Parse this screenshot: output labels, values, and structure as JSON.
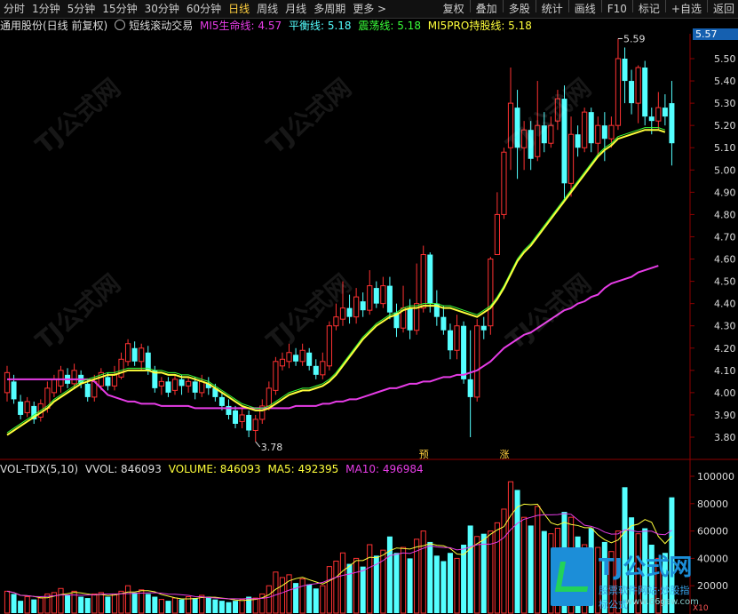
{
  "toolbar": {
    "periods": [
      "分时",
      "1分钟",
      "5分钟",
      "15分钟",
      "30分钟",
      "60分钟",
      "日线",
      "周线",
      "月线",
      "多周期",
      "更多 >"
    ],
    "active": "日线",
    "right_buttons": [
      "复权",
      "叠加",
      "多股",
      "统计",
      "画线",
      "F10",
      "标记",
      "+自选",
      "返回"
    ]
  },
  "infobar": {
    "stock": "通用股份(日线 前复权)",
    "indicator": "短线滚动交易",
    "mi5_life": "MI5生命线: 4.57",
    "balance": "平衡线: 5.18",
    "oscillation": "震荡线: 5.18",
    "mi5pro": "MI5PRO持股线: 5.18"
  },
  "price_axis": {
    "current": "5.57",
    "ticks": [
      "5.50",
      "5.40",
      "5.30",
      "5.20",
      "5.10",
      "5.00",
      "4.90",
      "4.80",
      "4.70",
      "4.60",
      "4.50",
      "4.40",
      "4.30",
      "4.20",
      "4.10",
      "4.00",
      "3.90",
      "3.80"
    ]
  },
  "annotations": {
    "high": "5.59",
    "low": "3.78",
    "mark1": "预",
    "mark2": "涨"
  },
  "volume": {
    "name": "VOL-TDX(5,10)",
    "vvol": "VVOL: 846093",
    "volume": "VOLUME: 846093",
    "ma5": "MA5: 492395",
    "ma10": "MA10: 496984",
    "ticks": [
      "100000",
      "80000",
      "60000",
      "40000",
      "20000"
    ],
    "unit": "X10"
  },
  "watermark": {
    "text": "TJ公式网"
  },
  "logo": {
    "text": "TJ公式网",
    "sub": "股票软件网站·炒股指标公式",
    "url": "www.66gsw.com"
  },
  "colors": {
    "up": "#ff3232",
    "down": "#54ffff",
    "ma_yellow": "#ffff3b",
    "ma_magenta": "#e63ce6",
    "ma_white": "#ffffff"
  },
  "chart_data": {
    "type": "candlestick",
    "candles": [
      [
        4.0,
        4.09,
        4.12,
        3.96
      ],
      [
        4.05,
        3.97,
        4.08,
        3.95
      ],
      [
        3.96,
        3.9,
        3.99,
        3.88
      ],
      [
        3.91,
        3.96,
        3.98,
        3.89
      ],
      [
        3.94,
        3.88,
        3.96,
        3.86
      ],
      [
        3.89,
        3.95,
        3.97,
        3.87
      ],
      [
        3.93,
        4.02,
        4.05,
        3.91
      ],
      [
        4.0,
        4.06,
        4.08,
        3.98
      ],
      [
        4.03,
        4.1,
        4.12,
        4.0
      ],
      [
        4.08,
        4.04,
        4.11,
        4.02
      ],
      [
        4.04,
        4.1,
        4.13,
        4.02
      ],
      [
        4.08,
        4.04,
        4.1,
        4.02
      ],
      [
        4.04,
        3.98,
        4.06,
        3.96
      ],
      [
        3.98,
        4.05,
        4.08,
        3.96
      ],
      [
        4.03,
        4.09,
        4.11,
        4.01
      ],
      [
        4.07,
        4.03,
        4.09,
        4.01
      ],
      [
        4.03,
        4.08,
        4.12,
        4.01
      ],
      [
        4.07,
        4.15,
        4.18,
        4.06
      ],
      [
        4.14,
        4.22,
        4.24,
        4.12
      ],
      [
        4.2,
        4.14,
        4.23,
        4.12
      ],
      [
        4.14,
        4.2,
        4.22,
        4.1
      ],
      [
        4.18,
        4.1,
        4.21,
        4.08
      ],
      [
        4.1,
        4.02,
        4.12,
        4.0
      ],
      [
        4.03,
        4.05,
        4.07,
        3.99
      ],
      [
        4.05,
        4.0,
        4.07,
        3.98
      ],
      [
        4.01,
        4.06,
        4.08,
        3.99
      ],
      [
        4.06,
        4.03,
        4.08,
        3.99
      ],
      [
        4.03,
        4.05,
        4.07,
        4.0
      ],
      [
        4.05,
        4.0,
        4.07,
        3.97
      ],
      [
        4.0,
        4.05,
        4.08,
        3.98
      ],
      [
        4.04,
        4.02,
        4.07,
        3.99
      ],
      [
        4.02,
        3.98,
        4.04,
        3.96
      ],
      [
        3.98,
        3.94,
        4.0,
        3.92
      ],
      [
        3.94,
        3.9,
        3.97,
        3.88
      ],
      [
        3.92,
        3.86,
        3.94,
        3.84
      ],
      [
        3.87,
        3.9,
        3.93,
        3.84
      ],
      [
        3.9,
        3.83,
        3.92,
        3.8
      ],
      [
        3.83,
        3.88,
        3.9,
        3.78
      ],
      [
        3.88,
        3.94,
        3.97,
        3.86
      ],
      [
        3.94,
        4.02,
        4.05,
        3.92
      ],
      [
        4.01,
        4.14,
        4.16,
        3.99
      ],
      [
        4.12,
        4.15,
        4.18,
        4.1
      ],
      [
        4.14,
        4.18,
        4.22,
        4.11
      ],
      [
        4.17,
        4.14,
        4.2,
        4.12
      ],
      [
        4.14,
        4.19,
        4.22,
        4.12
      ],
      [
        4.18,
        4.12,
        4.2,
        4.1
      ],
      [
        4.12,
        4.08,
        4.15,
        4.06
      ],
      [
        4.08,
        4.14,
        4.18,
        4.06
      ],
      [
        4.12,
        4.3,
        4.32,
        4.1
      ],
      [
        4.3,
        4.34,
        4.4,
        4.28
      ],
      [
        4.33,
        4.38,
        4.5,
        4.3
      ],
      [
        4.38,
        4.34,
        4.44,
        4.31
      ],
      [
        4.34,
        4.43,
        4.47,
        4.31
      ],
      [
        4.41,
        4.37,
        4.45,
        4.34
      ],
      [
        4.37,
        4.48,
        4.55,
        4.35
      ],
      [
        4.47,
        4.4,
        4.5,
        4.38
      ],
      [
        4.4,
        4.48,
        4.52,
        4.38
      ],
      [
        4.48,
        4.36,
        4.52,
        4.33
      ],
      [
        4.36,
        4.29,
        4.4,
        4.25
      ],
      [
        4.29,
        4.38,
        4.48,
        4.27
      ],
      [
        4.38,
        4.28,
        4.42,
        4.24
      ],
      [
        4.28,
        4.4,
        4.58,
        4.26
      ],
      [
        4.38,
        4.62,
        4.66,
        4.36
      ],
      [
        4.62,
        4.4,
        4.63,
        4.36
      ],
      [
        4.4,
        4.34,
        4.46,
        4.3
      ],
      [
        4.34,
        4.28,
        4.39,
        4.26
      ],
      [
        4.28,
        4.19,
        4.31,
        4.15
      ],
      [
        4.19,
        4.3,
        4.35,
        4.15
      ],
      [
        4.3,
        4.06,
        4.32,
        4.04
      ],
      [
        4.06,
        3.98,
        4.28,
        3.8
      ],
      [
        3.98,
        4.3,
        4.33,
        3.96
      ],
      [
        4.3,
        4.28,
        4.34,
        4.24
      ],
      [
        4.3,
        4.6,
        4.61,
        4.26
      ],
      [
        4.62,
        4.8,
        4.9,
        4.72
      ],
      [
        4.8,
        5.08,
        5.1,
        4.78
      ],
      [
        5.1,
        5.3,
        5.46,
        5.0
      ],
      [
        5.28,
        5.1,
        5.36,
        4.96
      ],
      [
        5.1,
        5.18,
        5.22,
        5.0
      ],
      [
        5.18,
        5.05,
        5.22,
        5.0
      ],
      [
        5.06,
        5.2,
        5.4,
        5.04
      ],
      [
        5.2,
        5.12,
        5.26,
        5.08
      ],
      [
        5.12,
        5.2,
        5.24,
        5.1
      ],
      [
        5.22,
        5.32,
        5.36,
        5.18
      ],
      [
        5.32,
        4.94,
        5.38,
        4.86
      ],
      [
        4.94,
        5.16,
        5.24,
        4.88
      ],
      [
        5.16,
        5.1,
        5.2,
        5.06
      ],
      [
        5.1,
        5.26,
        5.28,
        5.08
      ],
      [
        5.26,
        5.12,
        5.28,
        5.08
      ],
      [
        5.12,
        5.2,
        5.24,
        5.06
      ],
      [
        5.2,
        5.14,
        5.26,
        5.04
      ],
      [
        5.14,
        5.2,
        5.24,
        5.1
      ],
      [
        5.2,
        5.5,
        5.59,
        5.18
      ],
      [
        5.5,
        5.4,
        5.55,
        5.3
      ],
      [
        5.4,
        5.3,
        5.45,
        5.25
      ],
      [
        5.3,
        5.46,
        5.47,
        5.21
      ],
      [
        5.46,
        5.24,
        5.49,
        5.2
      ],
      [
        5.24,
        5.22,
        5.28,
        5.16
      ],
      [
        5.22,
        5.28,
        5.35,
        5.18
      ],
      [
        5.28,
        5.24,
        5.34,
        5.2
      ],
      [
        5.3,
        5.12,
        5.4,
        5.02
      ]
    ],
    "mi5_life": [
      4.06,
      4.06,
      4.06,
      4.06,
      4.06,
      4.06,
      4.06,
      4.06,
      4.06,
      4.06,
      4.06,
      4.06,
      4.06,
      4.05,
      4.02,
      3.99,
      3.98,
      3.97,
      3.96,
      3.96,
      3.95,
      3.95,
      3.95,
      3.94,
      3.94,
      3.94,
      3.94,
      3.94,
      3.93,
      3.93,
      3.93,
      3.93,
      3.93,
      3.93,
      3.93,
      3.93,
      3.93,
      3.93,
      3.93,
      3.93,
      3.93,
      3.93,
      3.93,
      3.94,
      3.94,
      3.94,
      3.94,
      3.95,
      3.95,
      3.96,
      3.96,
      3.97,
      3.97,
      3.98,
      3.99,
      4.0,
      4.01,
      4.02,
      4.02,
      4.03,
      4.04,
      4.04,
      4.05,
      4.05,
      4.06,
      4.07,
      4.07,
      4.08,
      4.08,
      4.09,
      4.1,
      4.12,
      4.14,
      4.17,
      4.2,
      4.22,
      4.24,
      4.26,
      4.27,
      4.29,
      4.31,
      4.33,
      4.35,
      4.37,
      4.38,
      4.4,
      4.41,
      4.43,
      4.44,
      4.47,
      4.49,
      4.5,
      4.51,
      4.52,
      4.54,
      4.55,
      4.56,
      4.57
    ],
    "mi5pro": [
      3.81,
      3.83,
      3.85,
      3.87,
      3.89,
      3.91,
      3.93,
      3.96,
      3.98,
      4.0,
      4.02,
      4.04,
      4.05,
      4.06,
      4.07,
      4.08,
      4.08,
      4.09,
      4.1,
      4.1,
      4.1,
      4.1,
      4.09,
      4.09,
      4.08,
      4.08,
      4.07,
      4.07,
      4.06,
      4.05,
      4.04,
      4.02,
      4.0,
      3.98,
      3.96,
      3.94,
      3.93,
      3.92,
      3.92,
      3.93,
      3.95,
      3.97,
      3.99,
      4.0,
      4.01,
      4.01,
      4.02,
      4.03,
      4.05,
      4.08,
      4.12,
      4.16,
      4.2,
      4.24,
      4.27,
      4.3,
      4.32,
      4.34,
      4.35,
      4.37,
      4.38,
      4.38,
      4.39,
      4.39,
      4.39,
      4.38,
      4.38,
      4.37,
      4.36,
      4.35,
      4.34,
      4.36,
      4.38,
      4.42,
      4.47,
      4.53,
      4.59,
      4.63,
      4.66,
      4.7,
      4.74,
      4.78,
      4.82,
      4.86,
      4.9,
      4.94,
      4.98,
      5.02,
      5.06,
      5.09,
      5.11,
      5.14,
      5.15,
      5.16,
      5.17,
      5.18,
      5.18,
      5.18,
      5.17
    ],
    "volume": [
      16000,
      14000,
      9000,
      12000,
      10000,
      11000,
      14000,
      15000,
      18000,
      13000,
      16000,
      12000,
      11000,
      14000,
      15000,
      12000,
      14000,
      16000,
      20000,
      15000,
      17000,
      14000,
      12000,
      10000,
      9000,
      11000,
      10000,
      12000,
      11000,
      13000,
      12000,
      10000,
      9000,
      8000,
      9000,
      10000,
      12000,
      11000,
      14000,
      20000,
      30000,
      26000,
      28000,
      22000,
      25000,
      21000,
      18000,
      20000,
      34000,
      38000,
      44000,
      36000,
      40000,
      34000,
      50000,
      42000,
      46000,
      56000,
      44000,
      48000,
      40000,
      54000,
      60000,
      52000,
      42000,
      38000,
      44000,
      40000,
      50000,
      64000,
      56000,
      58000,
      60000,
      66000,
      76000,
      96000,
      90000,
      70000,
      64000,
      78000,
      60000,
      58000,
      62000,
      74000,
      70000,
      56000,
      50000,
      62000,
      48000,
      52000,
      45000,
      60000,
      92000,
      70000,
      58000,
      62000,
      50000,
      40000,
      44000,
      84609
    ],
    "vol_ticks": [
      100000,
      80000,
      60000,
      40000,
      20000
    ]
  }
}
